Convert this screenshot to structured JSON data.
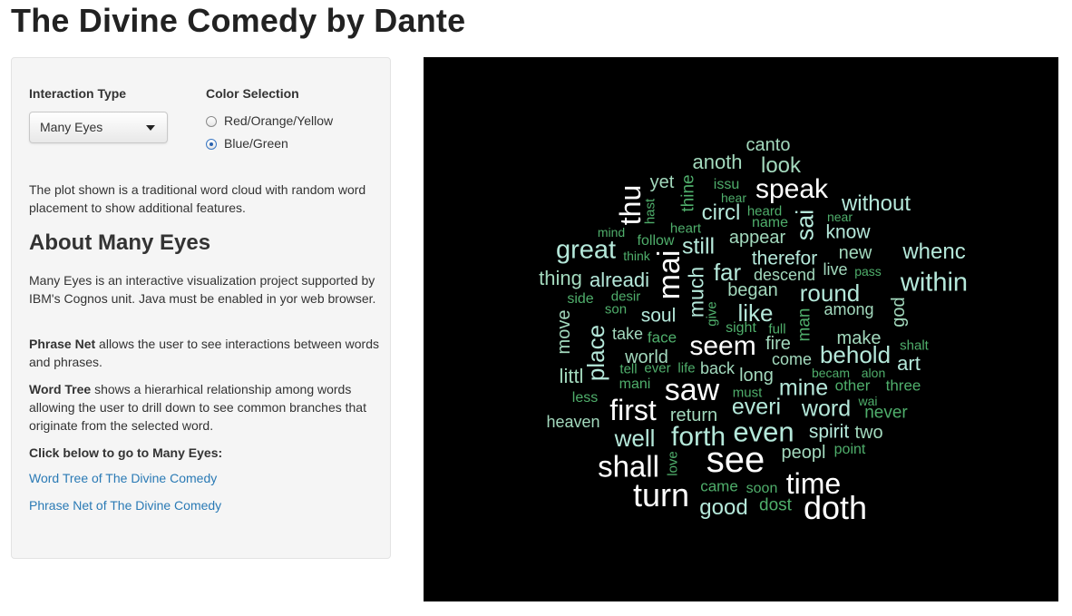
{
  "page": {
    "title": "The Divine Comedy by Dante"
  },
  "sidebar": {
    "interaction_label": "Interaction Type",
    "interaction_value": "Many Eyes",
    "color_label": "Color Selection",
    "color_options": [
      {
        "label": "Red/Orange/Yellow",
        "selected": false
      },
      {
        "label": "Blue/Green",
        "selected": true
      }
    ],
    "description": "The plot shown is a traditional word cloud with random word placement to show additional features.",
    "about_heading": "About Many Eyes",
    "about_text": "Many Eyes is an interactive visualization project supported by IBM's Cognos unit. Java must be enabled in yor web browser.",
    "phrase_net_term": "Phrase Net",
    "phrase_net_text": " allows the user to see interactions between words and phrases.",
    "word_tree_term": "Word Tree",
    "word_tree_text": " shows a hierarhical relationship among words allowing the user to drill down to see common branches that originate from the selected word.",
    "click_below": "Click below to go to Many Eyes:",
    "links": {
      "word_tree": "Word Tree of The Divine Comedy",
      "phrase_net": "Phrase Net of The Divine Comedy"
    }
  },
  "colors": {
    "large_words": "#ffffff",
    "medium_words": "#b5e8da",
    "small_words": "#a3d9bd",
    "smallest_words": "#4fae6b",
    "background": "#000000",
    "link": "#2a7ab5"
  },
  "word_cloud": {
    "words": [
      "canto",
      "anoth",
      "look",
      "yet",
      "thine",
      "issu",
      "hear",
      "speak",
      "thu",
      "hast",
      "circl",
      "heard",
      "name",
      "sai",
      "without",
      "near",
      "heart",
      "mind",
      "follow",
      "think",
      "great",
      "still",
      "appear",
      "know",
      "new",
      "whenc",
      "mai",
      "therefor",
      "live",
      "pass",
      "far",
      "descend",
      "thing",
      "alreadi",
      "within",
      "much",
      "began",
      "round",
      "side",
      "desir",
      "god",
      "soul",
      "son",
      "give",
      "like",
      "among",
      "move",
      "sight",
      "full",
      "take",
      "face",
      "man",
      "seem",
      "fire",
      "place",
      "world",
      "shalt",
      "make",
      "behold",
      "come",
      "tell",
      "ever",
      "life",
      "back",
      "art",
      "long",
      "becam",
      "alon",
      "littl",
      "mani",
      "mine",
      "other",
      "three",
      "must",
      "saw",
      "less",
      "wai",
      "everi",
      "word",
      "first",
      "heaven",
      "return",
      "never",
      "spirit",
      "two",
      "even",
      "well",
      "forth",
      "love",
      "point",
      "peopl",
      "see",
      "shall",
      "time",
      "came",
      "soon",
      "turn",
      "dost",
      "good",
      "doth"
    ]
  }
}
